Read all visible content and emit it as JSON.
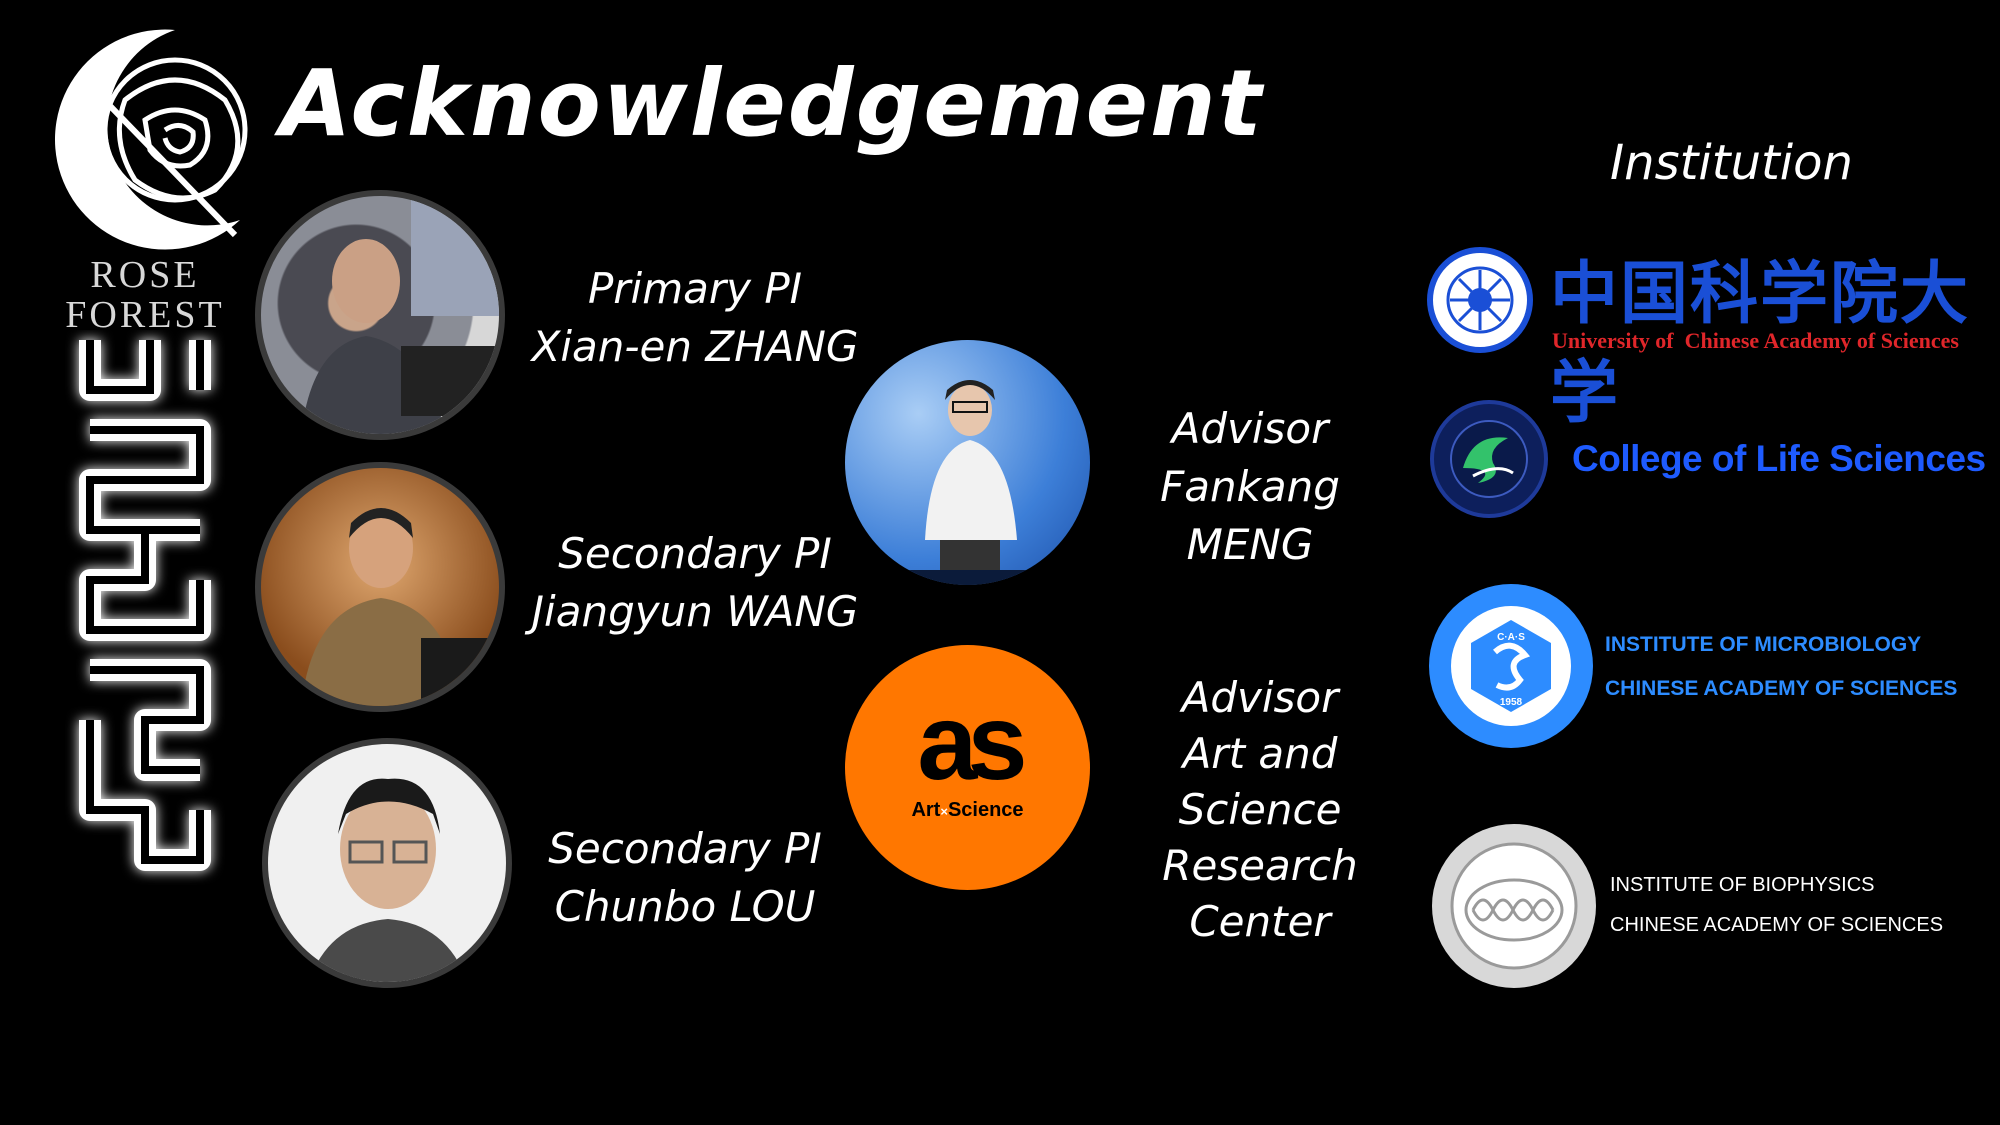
{
  "title": "Acknowledgement",
  "brand": {
    "line1": "ROSE",
    "line2": "FOREST"
  },
  "people": [
    {
      "role": "Primary PI",
      "name": "Xian-en ZHANG"
    },
    {
      "role": "Secondary PI",
      "name": "Jiangyun WANG"
    },
    {
      "role": "Secondary PI",
      "name": "Chunbo LOU"
    }
  ],
  "advisors": [
    {
      "role": "Advisor",
      "name": "Fankang MENG"
    },
    {
      "role": "Advisor",
      "name_line1": "Art and Science",
      "name_line2": "Research Center"
    }
  ],
  "as_logo": {
    "mark": "as",
    "caption_left": "Art",
    "caption_x": "×",
    "caption_right": "Science"
  },
  "institution": {
    "heading": "Institution",
    "ucas": {
      "chinese": "中国科学院大学",
      "english": "University of  Chinese Academy of Sciences"
    },
    "cls": {
      "name": "College of Life Sciences"
    },
    "im": {
      "line1": "INSTITUTE OF MICROBIOLOGY",
      "line2": "CHINESE ACADEMY OF SCIENCES",
      "seal_year": "1958",
      "seal_text": "C·A·S"
    },
    "ibp": {
      "line1": "INSTITUTE OF BIOPHYSICS",
      "line2": "CHINESE ACADEMY OF SCIENCES"
    }
  },
  "colors": {
    "background": "#000000",
    "ucas_blue": "#1a4fd6",
    "ucas_red": "#e0262a",
    "cls_blue": "#1e5bff",
    "im_blue": "#2d8cff",
    "as_orange": "#ff7700"
  }
}
